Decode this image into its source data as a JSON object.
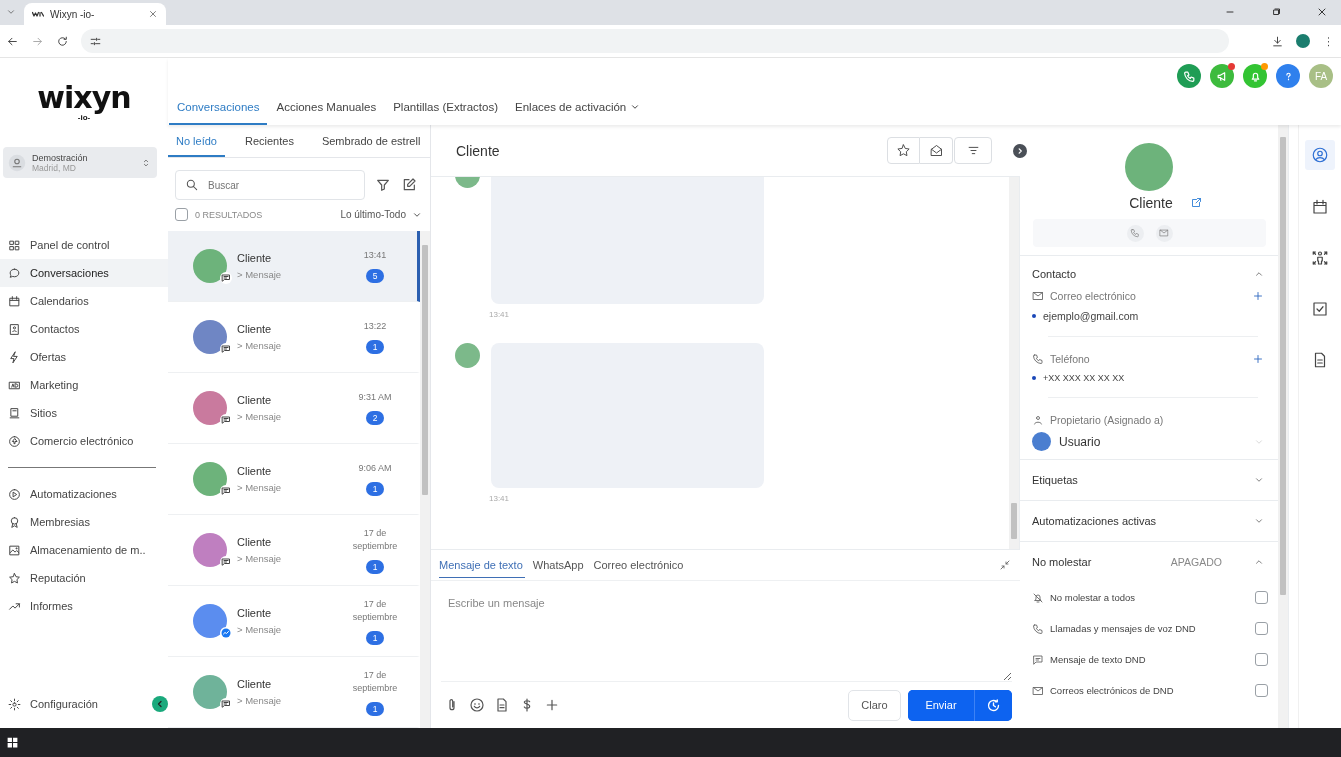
{
  "browser": {
    "tab_title": "Wixyn -io-"
  },
  "logo": {
    "name": "wixyn",
    "sub": "-io-"
  },
  "account": {
    "name": "Demostración",
    "location": "Madrid, MD"
  },
  "sidebar": {
    "items": [
      {
        "label": "Panel de control",
        "selected": false
      },
      {
        "label": "Conversaciones",
        "selected": true
      },
      {
        "label": "Calendarios",
        "selected": false
      },
      {
        "label": "Contactos",
        "selected": false
      },
      {
        "label": "Ofertas",
        "selected": false
      },
      {
        "label": "Marketing",
        "selected": false
      },
      {
        "label": "Sitios",
        "selected": false
      },
      {
        "label": "Comercio electrónico",
        "selected": false
      }
    ],
    "items_more": [
      {
        "label": "Automatizaciones",
        "selected": false
      },
      {
        "label": "Membresias",
        "selected": false
      },
      {
        "label": "Almacenamiento de m..",
        "selected": false
      },
      {
        "label": "Reputación",
        "selected": false
      },
      {
        "label": "Informes",
        "selected": false
      }
    ],
    "settings": "Configuración"
  },
  "user": {
    "initials": "FA"
  },
  "nav_tabs": [
    {
      "label": "Conversaciones",
      "selected": true,
      "kind": "link"
    },
    {
      "label": "Acciones Manuales",
      "selected": false,
      "kind": "link"
    },
    {
      "label": "Plantillas (Extractos)",
      "selected": false,
      "kind": "link"
    },
    {
      "label": "Enlaces de activación",
      "selected": false,
      "kind": "dropdown"
    }
  ],
  "list_tabs": [
    {
      "label": "No leído",
      "selected": true
    },
    {
      "label": "Recientes",
      "selected": false
    },
    {
      "label": "Sembrado de estrell",
      "selected": false
    }
  ],
  "search": {
    "placeholder": "Buscar"
  },
  "select_all": {
    "checked": false
  },
  "results": "0 RESULTADOS",
  "sort": "Lo último-Todo",
  "conversations": [
    {
      "name": "Cliente",
      "preview": "> Mensaje",
      "time": "13:41",
      "unread": "5",
      "color": "#6db37b",
      "kind": "sms",
      "selected": true
    },
    {
      "name": "Cliente",
      "preview": "> Mensaje",
      "time": "13:22",
      "unread": "1",
      "color": "#6f86c4",
      "kind": "sms",
      "selected": false
    },
    {
      "name": "Cliente",
      "preview": "> Mensaje",
      "time": "9:31 AM",
      "unread": "2",
      "color": "#c97a9e",
      "kind": "sms",
      "selected": false
    },
    {
      "name": "Cliente",
      "preview": "> Mensaje",
      "time": "9:06 AM",
      "unread": "1",
      "color": "#6db37b",
      "kind": "sms",
      "selected": false
    },
    {
      "name": "Cliente",
      "preview": "> Mensaje",
      "time": "17 de septiembre",
      "unread": "1",
      "color": "#bf7fc0",
      "kind": "sms",
      "selected": false
    },
    {
      "name": "Cliente",
      "preview": "> Mensaje",
      "time": "17 de septiembre",
      "unread": "1",
      "color": "#5b8def",
      "kind": "messenger",
      "selected": false
    },
    {
      "name": "Cliente",
      "preview": "> Mensaje",
      "time": "17 de septiembre",
      "unread": "1",
      "color": "#6fb39a",
      "kind": "sms",
      "selected": false
    }
  ],
  "chat": {
    "title": "Cliente",
    "messages": [
      {
        "time": "13:41"
      },
      {
        "time": "13:41"
      }
    ]
  },
  "compose": {
    "tabs": [
      {
        "label": "Mensaje de texto",
        "selected": true
      },
      {
        "label": "WhatsApp",
        "selected": false
      },
      {
        "label": "Correo electrónico",
        "selected": false
      }
    ],
    "placeholder": "Escribe un mensaje",
    "clear": "Claro",
    "send": "Enviar"
  },
  "contact": {
    "name": "Cliente",
    "section": {
      "title": "Contacto",
      "expanded": true
    },
    "email": {
      "label": "Correo electrónico",
      "value": "ejemplo@gmail.com"
    },
    "phone": {
      "label": "Teléfono",
      "value": "+XX XXX XX XX XX"
    },
    "owner": {
      "label": "Propietario (Asignado a)",
      "value": "Usuario"
    },
    "collapsed": [
      {
        "title": "Etiquetas",
        "expanded": false
      },
      {
        "title": "Automatizaciones activas",
        "expanded": false
      }
    ],
    "dnd": {
      "title": "No molestar",
      "status": "APAGADO",
      "expanded": true,
      "options": [
        {
          "label": "No molestar a todos",
          "checked": false
        },
        {
          "label": "Llamadas y mensajes de voz DND",
          "checked": false
        },
        {
          "label": "Mensaje de texto DND",
          "checked": false
        },
        {
          "label": "Correos electrónicos de DND",
          "checked": false
        }
      ]
    }
  }
}
